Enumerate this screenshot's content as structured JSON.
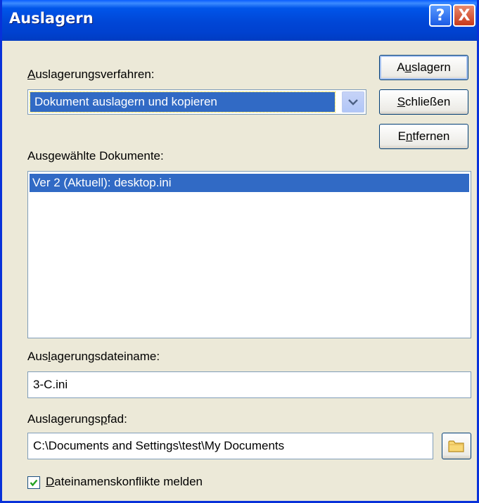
{
  "window": {
    "title": "Auslagern",
    "help_label": "?",
    "close_label": "X"
  },
  "procedure": {
    "label_pre": "",
    "label_ul": "A",
    "label_post": "uslagerungsverfahren:",
    "selected": "Dokument auslagern und kopieren"
  },
  "buttons": {
    "auslagern_pre": "A",
    "auslagern_ul": "u",
    "auslagern_post": "slagern",
    "schliessen_pre": "",
    "schliessen_ul": "S",
    "schliessen_post": "chließen",
    "entfernen_pre": "E",
    "entfernen_ul": "n",
    "entfernen_post": "tfernen"
  },
  "documents": {
    "label": "Ausgewählte Dokumente:",
    "items": [
      "Ver  2 (Aktuell): desktop.ini"
    ]
  },
  "filename": {
    "label_pre": "Aus",
    "label_ul": "l",
    "label_post": "agerungsdateiname:",
    "value": "3-C.ini"
  },
  "path": {
    "label_pre": "Auslagerungs",
    "label_ul": "p",
    "label_post": "fad:",
    "value": "C:\\Documents and Settings\\test\\My Documents"
  },
  "conflicts": {
    "checked": true,
    "label_ul": "D",
    "label_post": "ateinamenskonflikte melden"
  },
  "colors": {
    "titlebar": "#0054E3",
    "selection": "#316AC5",
    "window_bg": "#ECE9D8"
  }
}
